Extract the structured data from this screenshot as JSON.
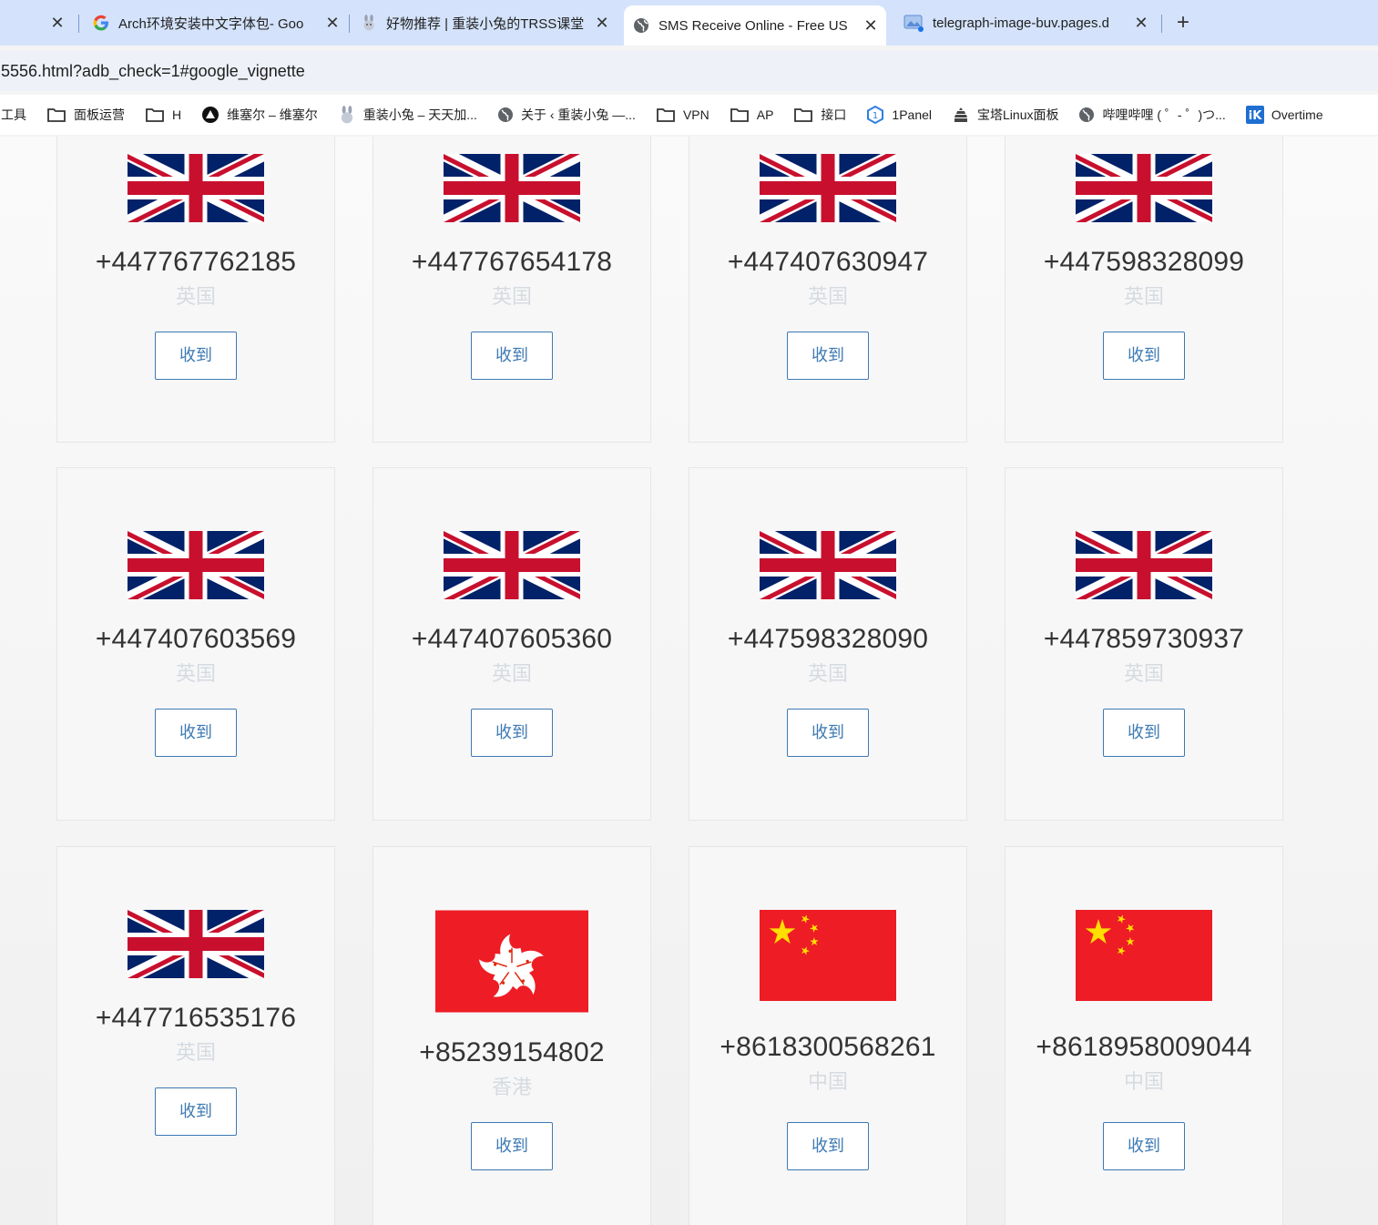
{
  "tabs": [
    {
      "title": "",
      "icon": "blank-favicon"
    },
    {
      "title": "Arch环境安装中文字体包- Goo",
      "icon": "google-icon"
    },
    {
      "title": "好物推荐 | 重装小兔的TRSS课堂",
      "icon": "rabbit-icon"
    },
    {
      "title": "SMS Receive Online - Free US",
      "icon": "globe-icon",
      "active": true
    },
    {
      "title": "telegraph-image-buv.pages.d",
      "icon": "image-icon"
    }
  ],
  "address_bar": {
    "url": "5556.html?adb_check=1#google_vignette"
  },
  "bookmarks": [
    {
      "label": "工具",
      "icon": "none"
    },
    {
      "label": "面板运营",
      "icon": "folder-icon"
    },
    {
      "label": "H",
      "icon": "folder-icon"
    },
    {
      "label": "维塞尔 – 维塞尔",
      "icon": "vercel-icon"
    },
    {
      "label": "重装小兔 – 天天加...",
      "icon": "rabbit-icon"
    },
    {
      "label": "关于 ‹ 重装小兔 —...",
      "icon": "globe-icon"
    },
    {
      "label": "VPN",
      "icon": "folder-icon"
    },
    {
      "label": "AP",
      "icon": "folder-icon"
    },
    {
      "label": "接口",
      "icon": "folder-icon"
    },
    {
      "label": "1Panel",
      "icon": "onepanel-icon"
    },
    {
      "label": "宝塔Linux面板",
      "icon": "baota-icon"
    },
    {
      "label": "哔哩哔哩 ( ゜- ゜)つ...",
      "icon": "globe-icon"
    },
    {
      "label": "Overtime",
      "icon": "ik-icon"
    }
  ],
  "cards": [
    {
      "number": "+447767762185",
      "country": "英国",
      "flag": "uk",
      "button": "收到"
    },
    {
      "number": "+447767654178",
      "country": "英国",
      "flag": "uk",
      "button": "收到"
    },
    {
      "number": "+447407630947",
      "country": "英国",
      "flag": "uk",
      "button": "收到"
    },
    {
      "number": "+447598328099",
      "country": "英国",
      "flag": "uk",
      "button": "收到"
    },
    {
      "number": "+447407603569",
      "country": "英国",
      "flag": "uk",
      "button": "收到"
    },
    {
      "number": "+447407605360",
      "country": "英国",
      "flag": "uk",
      "button": "收到"
    },
    {
      "number": "+447598328090",
      "country": "英国",
      "flag": "uk",
      "button": "收到"
    },
    {
      "number": "+447859730937",
      "country": "英国",
      "flag": "uk",
      "button": "收到"
    },
    {
      "number": "+447716535176",
      "country": "英国",
      "flag": "uk",
      "button": "收到"
    },
    {
      "number": "+85239154802",
      "country": "香港",
      "flag": "hk",
      "button": "收到"
    },
    {
      "number": "+8618300568261",
      "country": "中国",
      "flag": "cn",
      "button": "收到"
    },
    {
      "number": "+8618958009044",
      "country": "中国",
      "flag": "cn",
      "button": "收到"
    }
  ],
  "colors": {
    "button_accent": "#3d7ab3",
    "country_text": "#d6dbe0",
    "number_text": "#333333"
  }
}
